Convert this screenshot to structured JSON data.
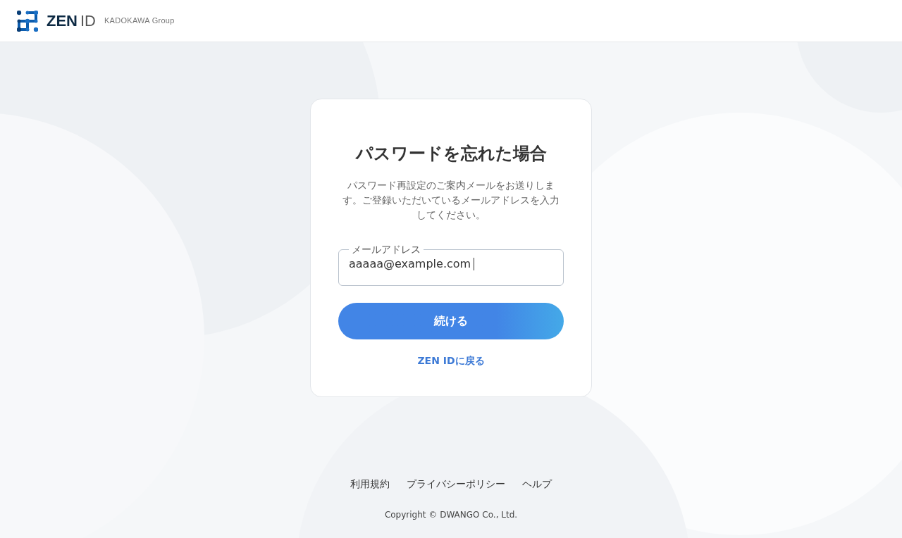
{
  "header": {
    "logo": {
      "primary": "ZEN",
      "secondary": "ID"
    },
    "group": "KADOKAWA Group"
  },
  "card": {
    "title": "パスワードを忘れた場合",
    "description": "パスワード再設定のご案内メールをお送りします。ご登録いただいているメールアドレスを入力してください。",
    "email_field": {
      "label": "メールアドレス",
      "value": "aaaaa@example.com",
      "focused": true
    },
    "submit": "続ける",
    "back_link": "ZEN IDに戻る"
  },
  "footer": {
    "links": [
      "利用規約",
      "プライバシーポリシー",
      "ヘルプ"
    ],
    "copyright": "Copyright © DWANGO Co., Ltd."
  }
}
